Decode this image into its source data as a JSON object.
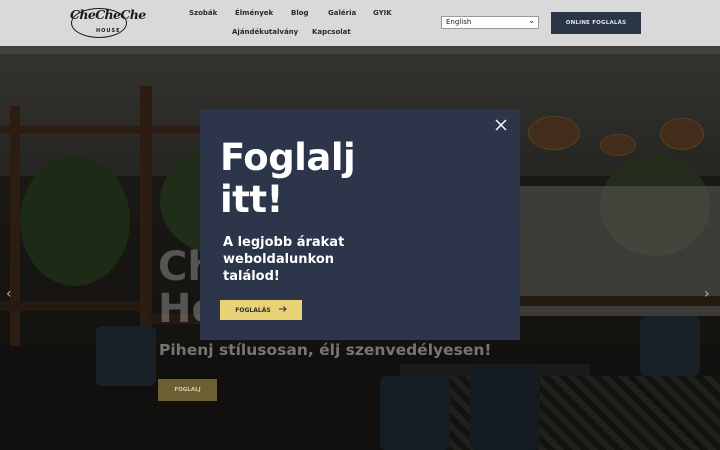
{
  "header": {
    "logo_text": "CheCheChe",
    "logo_sub": "HOUSE",
    "nav": [
      "Szobák",
      "Élmények",
      "Blog",
      "Galéria",
      "GYIK",
      "Ajándékutalvány",
      "Kapcsolat"
    ],
    "language": "English",
    "cta_label": "ONLINE FOGLALÁS"
  },
  "hero": {
    "title_line1": "Ch",
    "title_line2": "Ho",
    "tagline": "Pihenj stílusosan, élj szenvedélyesen!",
    "button_label": "FOGLALJ",
    "prev_icon": "chevron-left-icon",
    "next_icon": "chevron-right-icon"
  },
  "popup": {
    "title_line1": "Foglalj",
    "title_line2": "itt!",
    "text": "A legjobb árakat weboldalunkon találod!",
    "button_label": "FOGLALÁS",
    "button_icon": "arrow-right-icon",
    "close_icon": "close-icon"
  },
  "colors": {
    "header_bg": "#d9d9d9",
    "cta_bg": "#2b3548",
    "popup_bg": "#2c3549",
    "popup_button_bg": "#e9d275",
    "hero_button_bg": "#6d5f34"
  }
}
